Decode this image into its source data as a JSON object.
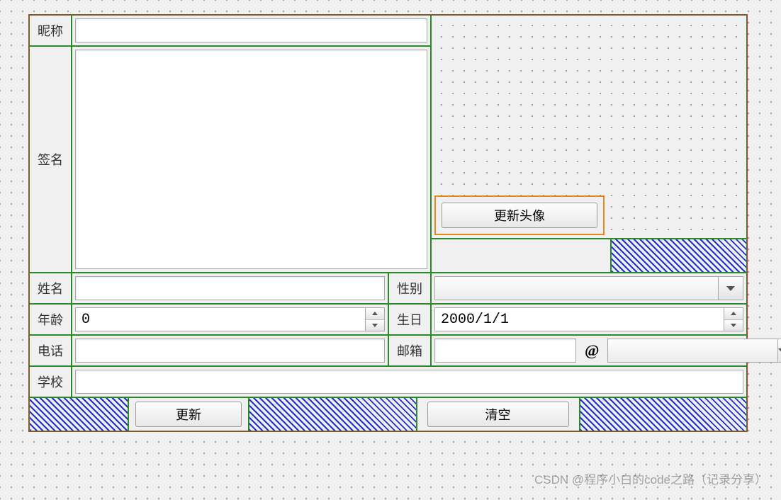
{
  "labels": {
    "nickname": "昵称",
    "signature": "签名",
    "name": "姓名",
    "gender": "性别",
    "age": "年龄",
    "birthday": "生日",
    "phone": "电话",
    "email": "邮箱",
    "school": "学校",
    "at": "@"
  },
  "values": {
    "nickname": "",
    "signature": "",
    "name": "",
    "gender": "",
    "age": "0",
    "birthday": "2000/1/1",
    "phone": "",
    "email_user": "",
    "email_domain": "",
    "school": ""
  },
  "buttons": {
    "update_avatar": "更新头像",
    "update": "更新",
    "clear": "清空"
  },
  "watermark": "CSDN @程序小白的code之路（记录分享）"
}
